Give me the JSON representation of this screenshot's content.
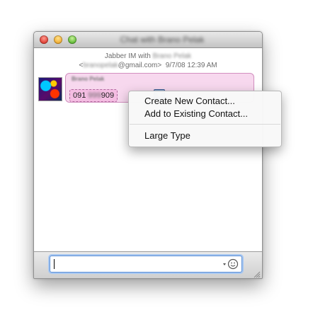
{
  "window": {
    "title": "Chat with Brano Pelak"
  },
  "chat_header": {
    "line1_prefix": "Jabber IM with",
    "line1_name": "Brano Pelak",
    "line2_open": "<",
    "line2_user": "branopelak",
    "line2_domain": "@gmail.com>",
    "timestamp": "9/7/08 12:39 AM"
  },
  "message": {
    "sender": "Brano Pelak",
    "phone_start": "091",
    "phone_middle": "999",
    "phone_end": "909"
  },
  "context_menu": {
    "items": [
      {
        "label": "Create New Contact..."
      },
      {
        "label": "Add to Existing Contact..."
      },
      {
        "label": "Large Type"
      }
    ]
  },
  "input": {
    "value": ""
  },
  "icons": {
    "menu_trigger": "chevron-down-icon",
    "emoticon": "smiley-icon",
    "resize": "resize-grip-icon"
  }
}
